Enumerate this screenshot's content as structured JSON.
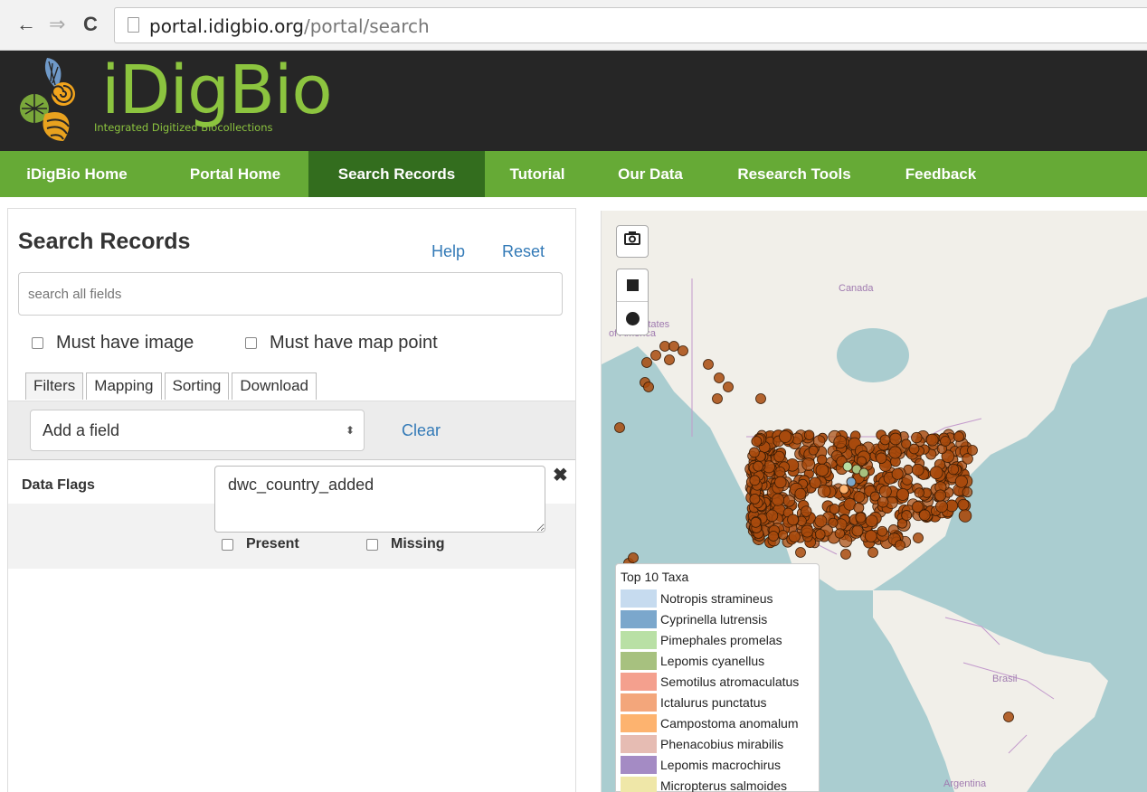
{
  "browser": {
    "back_icon": "←",
    "forward_icon": "⇒",
    "reload_icon": "C",
    "url_domain": "portal.idigbio.org",
    "url_path": "/portal/search"
  },
  "header": {
    "logo_text": "iDigBio",
    "tagline": "Integrated Digitized Biocollections"
  },
  "nav": {
    "items": [
      {
        "label": "iDigBio Home"
      },
      {
        "label": "Portal Home"
      },
      {
        "label": "Search Records"
      },
      {
        "label": "Tutorial"
      },
      {
        "label": "Our Data"
      },
      {
        "label": "Research Tools"
      },
      {
        "label": "Feedback"
      }
    ],
    "active": "Search Records"
  },
  "search_panel": {
    "title": "Search Records",
    "help_label": "Help",
    "reset_label": "Reset",
    "search_placeholder": "search all fields",
    "must_have_image": "Must have image",
    "must_have_map_point": "Must have map point",
    "tabs": [
      {
        "label": "Filters"
      },
      {
        "label": "Mapping"
      },
      {
        "label": "Sorting"
      },
      {
        "label": "Download"
      }
    ],
    "add_field_label": "Add a field",
    "clear_label": "Clear",
    "filter": {
      "label": "Data Flags",
      "value": "dwc_country_added",
      "present_label": "Present",
      "missing_label": "Missing",
      "remove_icon": "✖"
    }
  },
  "map": {
    "labels": {
      "canada": "Canada",
      "states": "States",
      "of_america": "of America",
      "brasil": "Brasil",
      "argentina": "Argentina"
    },
    "camera_icon": "camera-icon",
    "legend": {
      "title": "Top 10 Taxa",
      "items": [
        {
          "label": "Notropis stramineus",
          "color": "#c6dbef"
        },
        {
          "label": "Cyprinella lutrensis",
          "color": "#7ba7cc"
        },
        {
          "label": "Pimephales promelas",
          "color": "#b9e0a5"
        },
        {
          "label": "Lepomis cyanellus",
          "color": "#a7c17f"
        },
        {
          "label": "Semotilus atromaculatus",
          "color": "#f4a08e"
        },
        {
          "label": "Ictalurus punctatus",
          "color": "#f3a67b"
        },
        {
          "label": "Campostoma anomalum",
          "color": "#fdb36f"
        },
        {
          "label": "Phenacobius mirabilis",
          "color": "#e6bcb3"
        },
        {
          "label": "Lepomis macrochirus",
          "color": "#a48bc4"
        },
        {
          "label": "Micropterus salmoides",
          "color": "#efe7a8"
        }
      ]
    },
    "colors": {
      "water": "#aacdd0",
      "land": "#f1efe9",
      "border": "#c39acc",
      "point": "#a84a0d"
    }
  }
}
